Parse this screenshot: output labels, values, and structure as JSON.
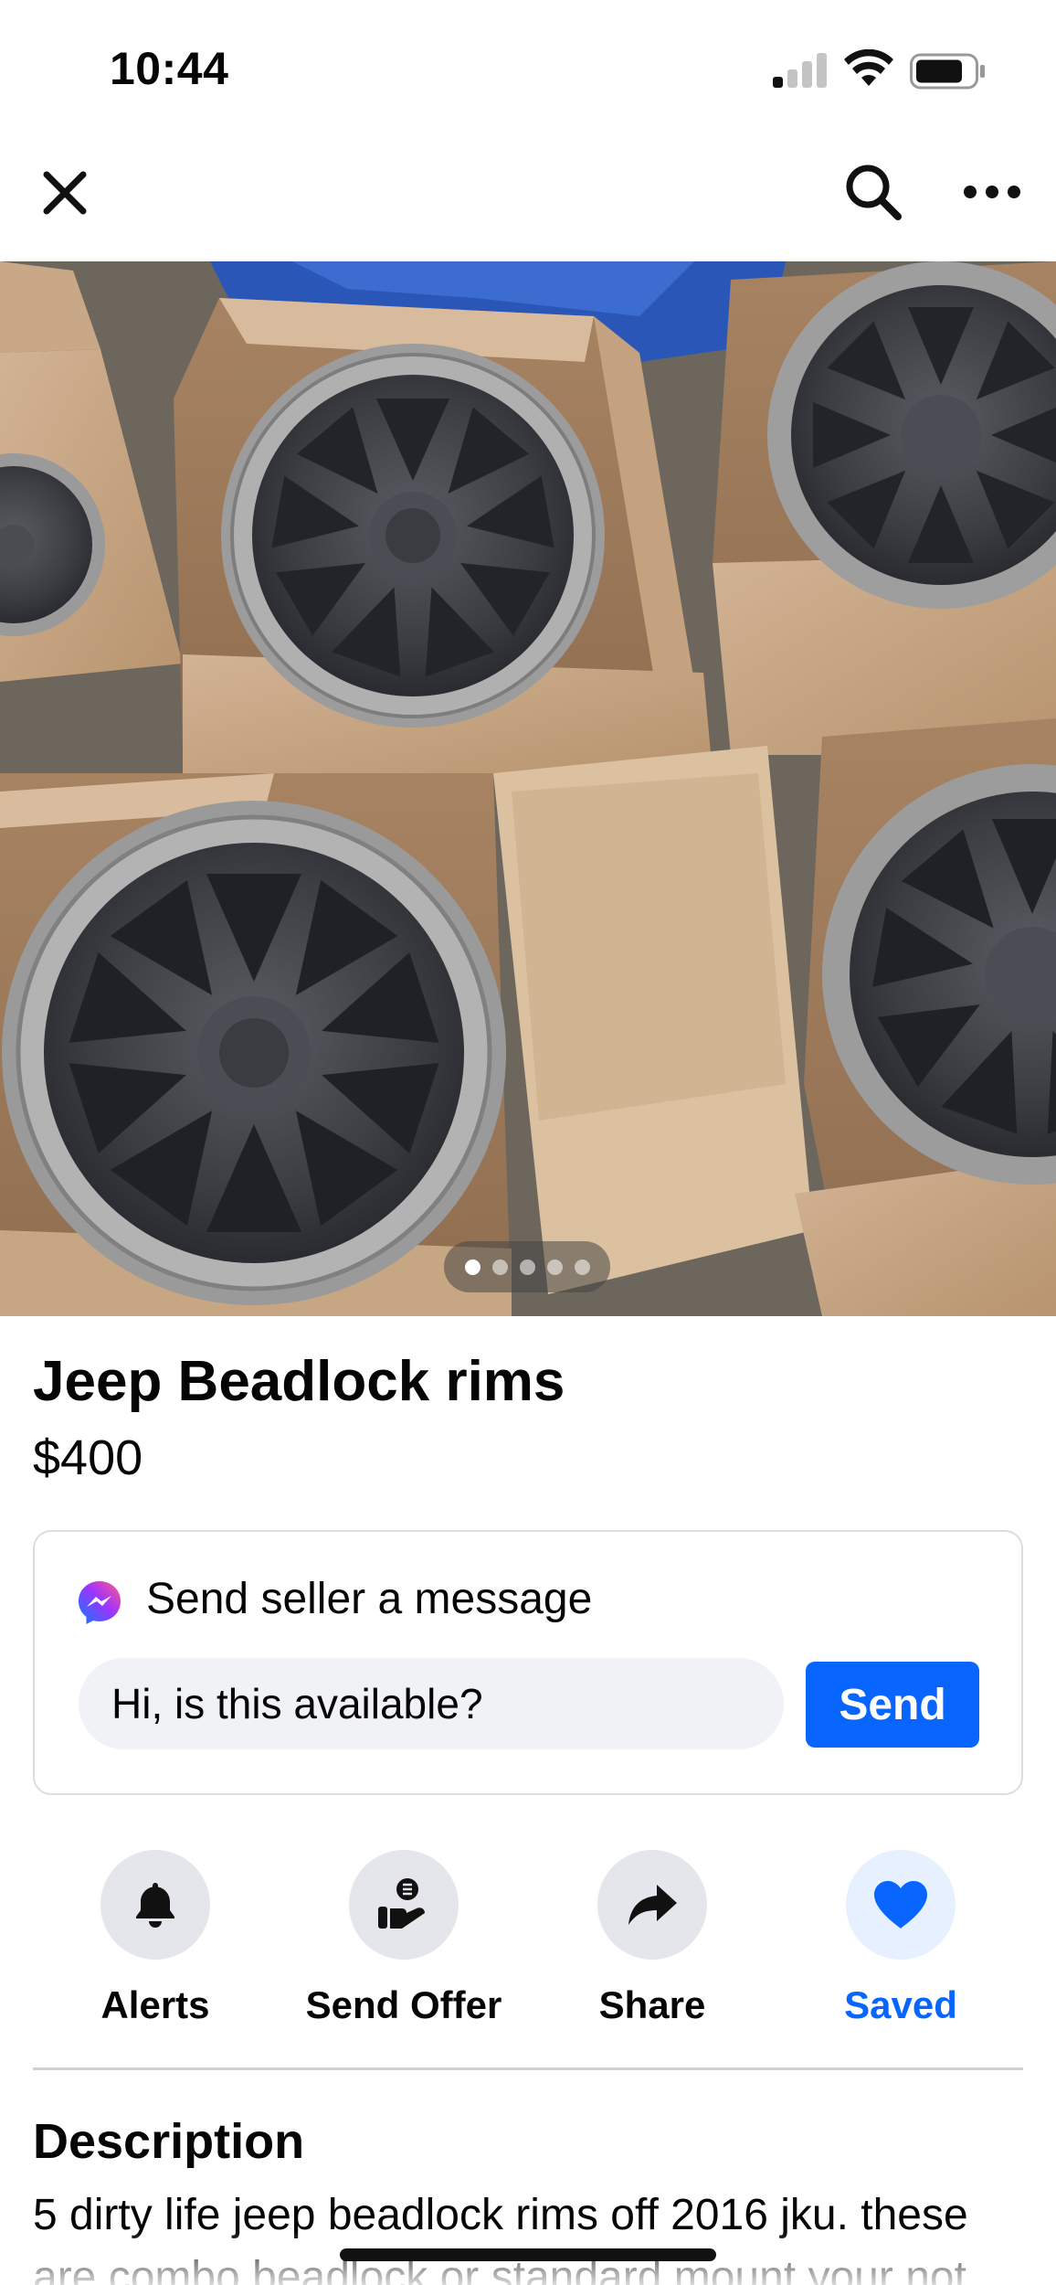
{
  "status_bar": {
    "time": "10:44"
  },
  "nav": {
    "close_icon": "close-icon",
    "search_icon": "search-icon",
    "more_icon": "more-icon"
  },
  "listing": {
    "photo_count": 5,
    "current_photo": 1,
    "title": "Jeep Beadlock rims",
    "price": "$400"
  },
  "message": {
    "heading": "Send seller a message",
    "input_value": "Hi, is this available?",
    "send_label": "Send"
  },
  "actions": [
    {
      "label": "Alerts",
      "icon": "bell-icon"
    },
    {
      "label": "Send Offer",
      "icon": "offer-hand-icon"
    },
    {
      "label": "Share",
      "icon": "share-arrow-icon"
    },
    {
      "label": "Saved",
      "icon": "heart-icon"
    }
  ],
  "description": {
    "heading": "Description",
    "text": "5 dirty life jeep beadlock rims off 2016 jku. these are combo beadlock or standard mount your not"
  },
  "colors": {
    "accent": "#0866ff",
    "saved_bg": "#e7f0fe",
    "button_bg": "#e4e6eb"
  }
}
